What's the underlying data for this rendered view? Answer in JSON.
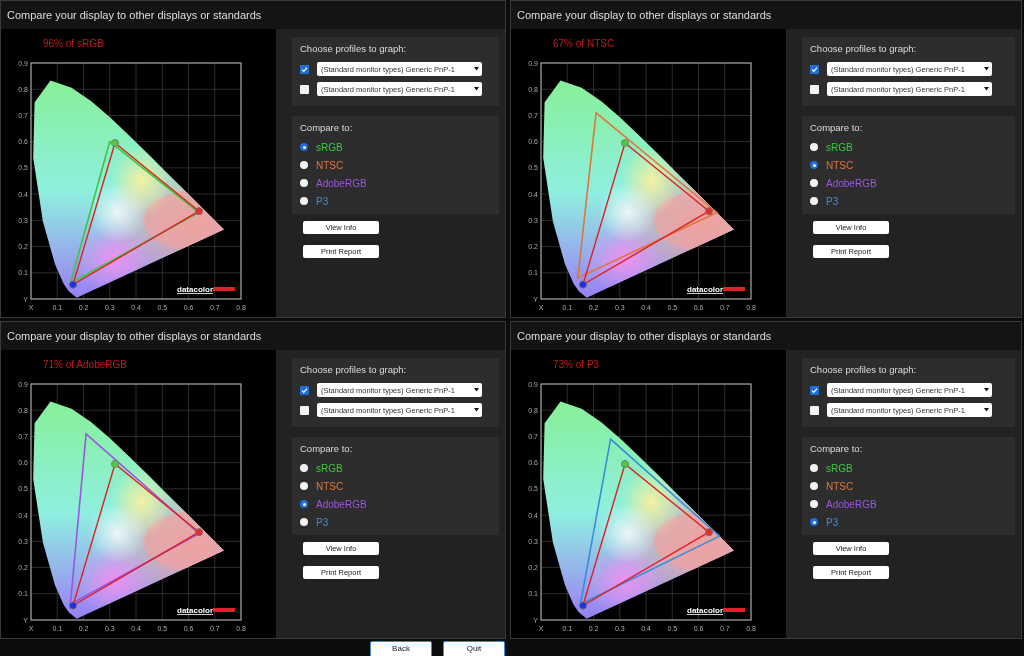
{
  "panels": [
    {
      "title": "Compare your display to other displays or standards",
      "coverage": "96% of sRGB",
      "y_ticks": [
        "0.9",
        "0.8",
        "0.7",
        "0.6",
        "0.5",
        "0.4",
        "0.3",
        "0.2",
        "0.1",
        "Y"
      ],
      "x_ticks": [
        "X",
        "0.1",
        "0.2",
        "0.3",
        "0.4",
        "0.5",
        "0.6",
        "0.7",
        "0.8"
      ],
      "logo": "datacolor",
      "profiles": {
        "title": "Choose profiles to graph:",
        "rows": [
          {
            "checked": true,
            "value": "(Standard monitor types) Generic PnP-1"
          },
          {
            "checked": false,
            "value": "(Standard monitor types) Generic PnP-1"
          }
        ]
      },
      "compare": {
        "title": "Compare to:",
        "options": [
          {
            "label": "sRGB",
            "color": "#3cc83c",
            "selected": true
          },
          {
            "label": "NTSC",
            "color": "#e0773a",
            "selected": false
          },
          {
            "label": "AdobeRGB",
            "color": "#9b55e0",
            "selected": false
          },
          {
            "label": "P3",
            "color": "#3a8ed8",
            "selected": false
          }
        ]
      },
      "buttons": [
        "View Info",
        "Print Report"
      ]
    },
    {
      "title": "Compare your display to other displays or standards",
      "coverage": "67% of NTSC",
      "y_ticks": [
        "0.9",
        "0.8",
        "0.7",
        "0.6",
        "0.5",
        "0.4",
        "0.3",
        "0.2",
        "0.1",
        "Y"
      ],
      "x_ticks": [
        "X",
        "0.1",
        "0.2",
        "0.3",
        "0.4",
        "0.5",
        "0.6",
        "0.7",
        "0.8"
      ],
      "logo": "datacolor",
      "profiles": {
        "title": "Choose profiles to graph:",
        "rows": [
          {
            "checked": true,
            "value": "(Standard monitor types) Generic PnP-1"
          },
          {
            "checked": false,
            "value": "(Standard monitor types) Generic PnP-1"
          }
        ]
      },
      "compare": {
        "title": "Compare to:",
        "options": [
          {
            "label": "sRGB",
            "color": "#3cc83c",
            "selected": false
          },
          {
            "label": "NTSC",
            "color": "#e0773a",
            "selected": true
          },
          {
            "label": "AdobeRGB",
            "color": "#9b55e0",
            "selected": false
          },
          {
            "label": "P3",
            "color": "#3a8ed8",
            "selected": false
          }
        ]
      },
      "buttons": [
        "View Info",
        "Print Report"
      ]
    },
    {
      "title": "Compare your display to other displays or standards",
      "coverage": "71% of AdobeRGB",
      "y_ticks": [
        "0.9",
        "0.8",
        "0.7",
        "0.6",
        "0.5",
        "0.4",
        "0.3",
        "0.2",
        "0.1",
        "Y"
      ],
      "x_ticks": [
        "X",
        "0.1",
        "0.2",
        "0.3",
        "0.4",
        "0.5",
        "0.6",
        "0.7",
        "0.8"
      ],
      "logo": "datacolor",
      "profiles": {
        "title": "Choose profiles to graph:",
        "rows": [
          {
            "checked": true,
            "value": "(Standard monitor types) Generic PnP-1"
          },
          {
            "checked": false,
            "value": "(Standard monitor types) Generic PnP-1"
          }
        ]
      },
      "compare": {
        "title": "Compare to:",
        "options": [
          {
            "label": "sRGB",
            "color": "#3cc83c",
            "selected": false
          },
          {
            "label": "NTSC",
            "color": "#e0773a",
            "selected": false
          },
          {
            "label": "AdobeRGB",
            "color": "#9b55e0",
            "selected": true
          },
          {
            "label": "P3",
            "color": "#3a8ed8",
            "selected": false
          }
        ]
      },
      "buttons": [
        "View Info",
        "Print Report"
      ]
    },
    {
      "title": "Compare your display to other displays or standards",
      "coverage": "73% of P3",
      "y_ticks": [
        "0.9",
        "0.8",
        "0.7",
        "0.6",
        "0.5",
        "0.4",
        "0.3",
        "0.2",
        "0.1",
        "Y"
      ],
      "x_ticks": [
        "X",
        "0.1",
        "0.2",
        "0.3",
        "0.4",
        "0.5",
        "0.6",
        "0.7",
        "0.8"
      ],
      "logo": "datacolor",
      "profiles": {
        "title": "Choose profiles to graph:",
        "rows": [
          {
            "checked": true,
            "value": "(Standard monitor types) Generic PnP-1"
          },
          {
            "checked": false,
            "value": "(Standard monitor types) Generic PnP-1"
          }
        ]
      },
      "compare": {
        "title": "Compare to:",
        "options": [
          {
            "label": "sRGB",
            "color": "#3cc83c",
            "selected": false
          },
          {
            "label": "NTSC",
            "color": "#e0773a",
            "selected": false
          },
          {
            "label": "AdobeRGB",
            "color": "#9b55e0",
            "selected": false
          },
          {
            "label": "P3",
            "color": "#3a8ed8",
            "selected": true
          }
        ]
      },
      "buttons": [
        "View Info",
        "Print Report"
      ]
    }
  ],
  "footer_buttons": [
    "Back",
    "Quit"
  ]
}
